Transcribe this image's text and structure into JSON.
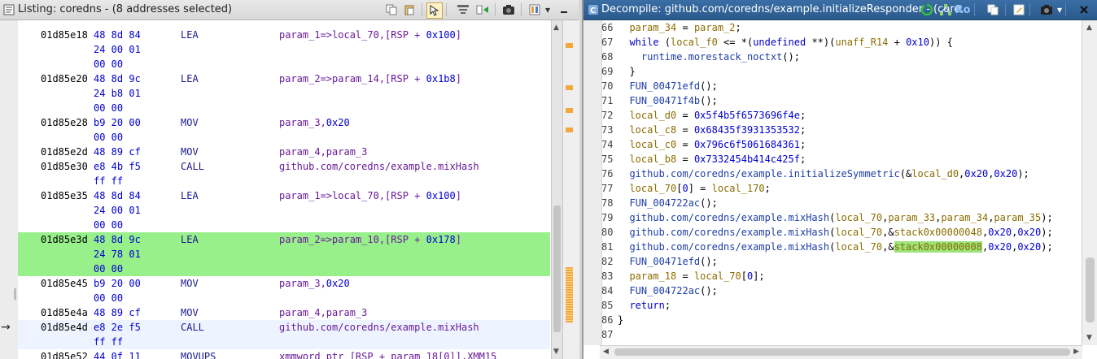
{
  "listing": {
    "title": "Listing:  coredns - (8 addresses selected)",
    "rows": [
      {
        "addr": "01d85e18",
        "bytes": "48 8d 84",
        "mnem": "LEA",
        "ops_a": "param_1=>local_70,[RSP + ",
        "ops_n": "0x100",
        "ops_b": "]"
      },
      {
        "addr": "",
        "bytes": "24 00 01",
        "mnem": "",
        "ops_a": "",
        "ops_n": "",
        "ops_b": ""
      },
      {
        "addr": "",
        "bytes": "00 00",
        "mnem": "",
        "ops_a": "",
        "ops_n": "",
        "ops_b": ""
      },
      {
        "addr": "01d85e20",
        "bytes": "48 8d 9c",
        "mnem": "LEA",
        "ops_a": "param_2=>param_14,[RSP + ",
        "ops_n": "0x1b8",
        "ops_b": "]"
      },
      {
        "addr": "",
        "bytes": "24 b8 01",
        "mnem": "",
        "ops_a": "",
        "ops_n": "",
        "ops_b": ""
      },
      {
        "addr": "",
        "bytes": "00 00",
        "mnem": "",
        "ops_a": "",
        "ops_n": "",
        "ops_b": ""
      },
      {
        "addr": "01d85e28",
        "bytes": "b9 20 00",
        "mnem": "MOV",
        "ops_a": "param_3,",
        "ops_n": "0x20",
        "ops_b": ""
      },
      {
        "addr": "",
        "bytes": "00 00",
        "mnem": "",
        "ops_a": "",
        "ops_n": "",
        "ops_b": ""
      },
      {
        "addr": "01d85e2d",
        "bytes": "48 89 cf",
        "mnem": "MOV",
        "ops_a": "param_4,param_3",
        "ops_n": "",
        "ops_b": ""
      },
      {
        "addr": "01d85e30",
        "bytes": "e8 4b f5",
        "mnem": "CALL",
        "ops_a": "github.com/coredns/example.mixHash",
        "ops_n": "",
        "ops_b": ""
      },
      {
        "addr": "",
        "bytes": "ff ff",
        "mnem": "",
        "ops_a": "",
        "ops_n": "",
        "ops_b": ""
      },
      {
        "addr": "01d85e35",
        "bytes": "48 8d 84",
        "mnem": "LEA",
        "ops_a": "param_1=>local_70,[RSP + ",
        "ops_n": "0x100",
        "ops_b": "]"
      },
      {
        "addr": "",
        "bytes": "24 00 01",
        "mnem": "",
        "ops_a": "",
        "ops_n": "",
        "ops_b": ""
      },
      {
        "addr": "",
        "bytes": "00 00",
        "mnem": "",
        "ops_a": "",
        "ops_n": "",
        "ops_b": ""
      },
      {
        "addr": "01d85e3d",
        "bytes": "48 8d 9c",
        "mnem": "LEA",
        "ops_a": "param_2=>param_10,[RSP + ",
        "ops_n": "0x178",
        "ops_b": "]"
      },
      {
        "addr": "",
        "bytes": "24 78 01",
        "mnem": "",
        "ops_a": "",
        "ops_n": "",
        "ops_b": ""
      },
      {
        "addr": "",
        "bytes": "00 00",
        "mnem": "",
        "ops_a": "",
        "ops_n": "",
        "ops_b": ""
      },
      {
        "addr": "01d85e45",
        "bytes": "b9 20 00",
        "mnem": "MOV",
        "ops_a": "param_3,",
        "ops_n": "0x20",
        "ops_b": ""
      },
      {
        "addr": "",
        "bytes": "00 00",
        "mnem": "",
        "ops_a": "",
        "ops_n": "",
        "ops_b": ""
      },
      {
        "addr": "01d85e4a",
        "bytes": "48 89 cf",
        "mnem": "MOV",
        "ops_a": "param_4,param_3",
        "ops_n": "",
        "ops_b": ""
      },
      {
        "addr": "01d85e4d",
        "bytes": "e8 2e f5",
        "mnem": "CALL",
        "ops_a": "github.com/coredns/example.mixHash",
        "ops_n": "",
        "ops_b": ""
      },
      {
        "addr": "",
        "bytes": "ff ff",
        "mnem": "",
        "ops_a": "",
        "ops_n": "",
        "ops_b": ""
      },
      {
        "addr": "01d85e52",
        "bytes": "44 0f 11",
        "mnem": "MOVUPS",
        "ops_a": "xmmword ptr [RSP + param_18[0]],XMM15",
        "ops_n": "",
        "ops_b": ""
      }
    ],
    "selected_rows": [
      14,
      15,
      16
    ],
    "cursor_row": 20,
    "colors": {
      "selection": "#98f08a",
      "cursor_line": "#eef4ff",
      "overview_mark": "#f2a93b"
    }
  },
  "decompile": {
    "title": "Decompile: github.com/coredns/example.initializeResponder - (core...",
    "lines": [
      {
        "n": "66",
        "html": "  <span class='var'>param_34</span> = <span class='var'>param_2</span>;"
      },
      {
        "n": "67",
        "html": "  <span class='kw'>while</span> (<span class='var'>local_f0</span> &lt;= *(<span class='kw'>undefined</span> **)(<span class='var'>unaff_R14</span> + <span class='num'>0x10</span>)) {"
      },
      {
        "n": "68",
        "html": "    <span class='fn'>runtime.morestack_noctxt</span>();"
      },
      {
        "n": "69",
        "html": "  }"
      },
      {
        "n": "70",
        "html": "  <span class='fn'>FUN_00471efd</span>();"
      },
      {
        "n": "71",
        "html": "  <span class='fn'>FUN_00471f4b</span>();"
      },
      {
        "n": "72",
        "html": "  <span class='var'>local_d0</span> = <span class='num'>0x5f4b5f6573696f4e</span>;"
      },
      {
        "n": "73",
        "html": "  <span class='var'>local_c8</span> = <span class='num'>0x68435f3931353532</span>;"
      },
      {
        "n": "74",
        "html": "  <span class='var'>local_c0</span> = <span class='num'>0x796c6f5061684361</span>;"
      },
      {
        "n": "75",
        "html": "  <span class='var'>local_b8</span> = <span class='num'>0x7332454b414c425f</span>;"
      },
      {
        "n": "76",
        "html": "  <span class='fn'>github.com/coredns/example.initializeSymmetric</span>(&amp;<span class='var'>local_d0</span>,<span class='num'>0x20</span>,<span class='num'>0x20</span>);"
      },
      {
        "n": "77",
        "html": "  <span class='var'>local_70</span>[<span class='num'>0</span>] = <span class='var'>local_170</span>;"
      },
      {
        "n": "78",
        "html": "  <span class='fn'>FUN_004722ac</span>();"
      },
      {
        "n": "79",
        "html": "  <span class='fn'>github.com/coredns/example.mixHash</span>(<span class='var'>local_70</span>,<span class='var'>param_33</span>,<span class='var'>param_34</span>,<span class='var'>param_35</span>);"
      },
      {
        "n": "80",
        "html": "  <span class='fn'>github.com/coredns/example.mixHash</span>(<span class='var'>local_70</span>,&amp;<span class='var'>stack0x00000048</span>,<span class='num'>0x20</span>,<span class='num'>0x20</span>);"
      },
      {
        "n": "81",
        "html": "  <span class='fn'>github.com/coredns/example.mixHash</span>(<span class='var'>local_70</span>,&amp;<span class='var hl'>stack0x00000008</span>,<span class='num'>0x20</span>,<span class='num'>0x20</span>);"
      },
      {
        "n": "82",
        "html": "  <span class='fn'>FUN_00471efd</span>();"
      },
      {
        "n": "83",
        "html": "  <span class='var'>param_18</span> = <span class='var'>local_70</span>[<span class='num'>0</span>];"
      },
      {
        "n": "84",
        "html": "  <span class='fn'>FUN_004722ac</span>();"
      },
      {
        "n": "85",
        "html": "  <span class='kw'>return</span>;"
      },
      {
        "n": "86",
        "html": "}"
      },
      {
        "n": "87",
        "html": ""
      }
    ]
  }
}
